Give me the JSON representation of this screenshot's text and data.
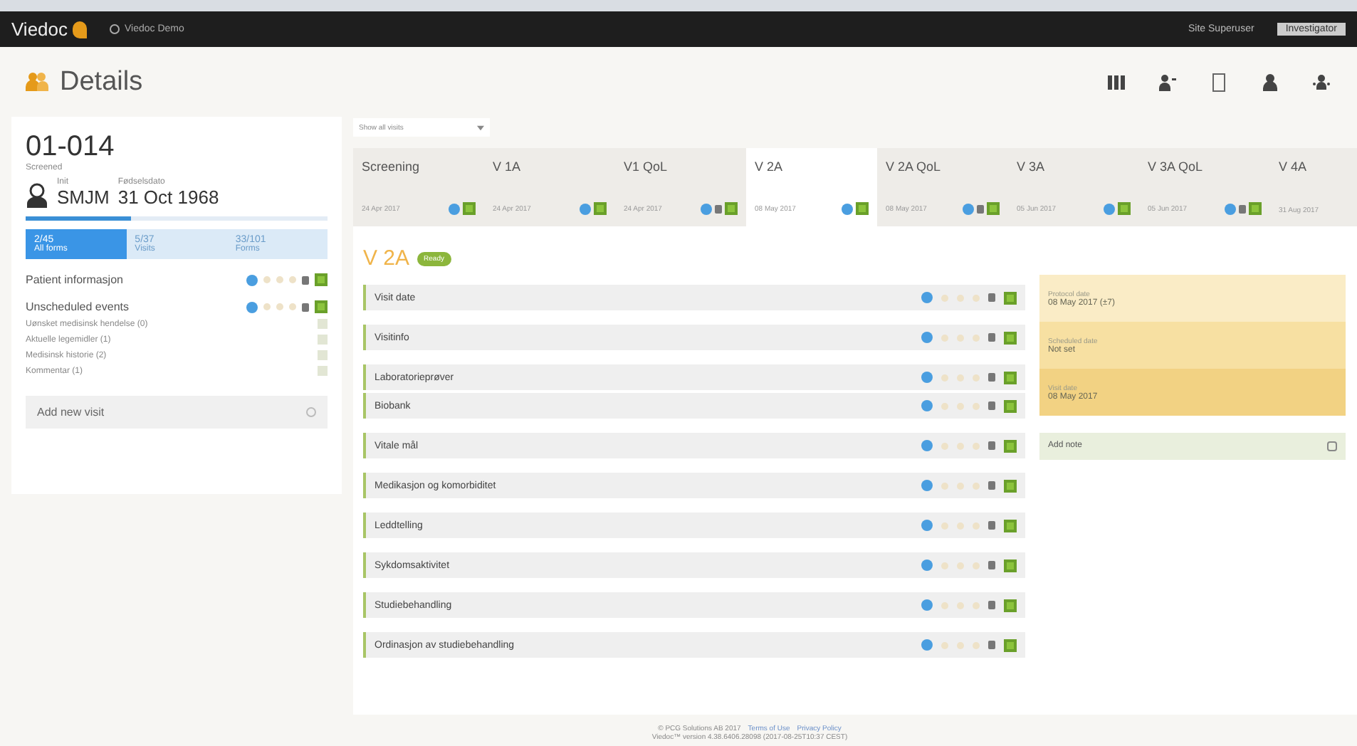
{
  "topbar": {
    "logo": "Viedoc",
    "study": "Viedoc Demo",
    "user": "Site Superuser",
    "role": "Investigator"
  },
  "header": {
    "title": "Details"
  },
  "subject": {
    "id": "01-014",
    "status": "Screened",
    "initials_label": "Init",
    "initials": "SMJM",
    "dob_label": "Fødselsdato",
    "dob": "31 Oct 1968",
    "level": 0.35,
    "tabs": [
      {
        "count": "2/45",
        "label": "All forms",
        "selected": true
      },
      {
        "count": "5/37",
        "label": "Visits",
        "selected": false
      },
      {
        "count": "33/101",
        "label": "Forms",
        "selected": false
      }
    ],
    "sections": [
      {
        "title": "Patient informasjon"
      },
      {
        "title": "Unscheduled events",
        "items": [
          "Uønsket medisinsk hendelse (0)",
          "Aktuelle legemidler (1)",
          "Medisinsk historie (2)",
          "Kommentar (1)"
        ]
      }
    ],
    "add_visit": "Add new visit"
  },
  "filter": {
    "value": "Show all visits"
  },
  "visits": [
    {
      "name": "Screening",
      "date": "24 Apr 2017",
      "locked": false,
      "selected": false
    },
    {
      "name": "V 1A",
      "date": "24 Apr 2017",
      "locked": false,
      "selected": false
    },
    {
      "name": "V1 QoL",
      "date": "24 Apr 2017",
      "locked": true,
      "selected": false
    },
    {
      "name": "V 2A",
      "date": "08 May 2017",
      "locked": false,
      "selected": true
    },
    {
      "name": "V 2A QoL",
      "date": "08 May 2017",
      "locked": true,
      "selected": false
    },
    {
      "name": "V 3A",
      "date": "05 Jun 2017",
      "locked": false,
      "selected": false
    },
    {
      "name": "V 3A QoL",
      "date": "05 Jun 2017",
      "locked": true,
      "selected": false
    },
    {
      "name": "V 4A",
      "date": "31 Aug 2017",
      "selected": false,
      "status_icons": false
    }
  ],
  "visit": {
    "title": "V 2A",
    "badge": "Ready",
    "forms": [
      {
        "name": "Visit date",
        "grouped": false
      },
      {
        "name": "Visitinfo",
        "grouped": false
      },
      {
        "name": "Laboratorieprøver",
        "grouped": true
      },
      {
        "name": "Biobank",
        "grouped": false
      },
      {
        "name": "Vitale mål",
        "grouped": false
      },
      {
        "name": "Medikasjon og komorbiditet",
        "grouped": false
      },
      {
        "name": "Leddtelling",
        "grouped": false
      },
      {
        "name": "Sykdomsaktivitet",
        "grouped": false
      },
      {
        "name": "Studiebehandling",
        "grouped": false
      },
      {
        "name": "Ordinasjon av studiebehandling",
        "grouped": false
      }
    ]
  },
  "dates": [
    {
      "label": "Protocol date",
      "value": "08 May 2017 (±7)",
      "color": "#faecc6"
    },
    {
      "label": "Scheduled date",
      "value": "Not set",
      "color": "#f7e0a2"
    },
    {
      "label": "Visit date",
      "value": "08 May 2017",
      "color": "#f2d283"
    }
  ],
  "note": "Add note",
  "footer": {
    "copyright": "© PCG Solutions AB 2017",
    "links": [
      "Terms of Use",
      "Privacy Policy"
    ],
    "version": "Viedoc™ version 4.38.6406.28098 (2017-08-25T10:37 CEST)"
  }
}
